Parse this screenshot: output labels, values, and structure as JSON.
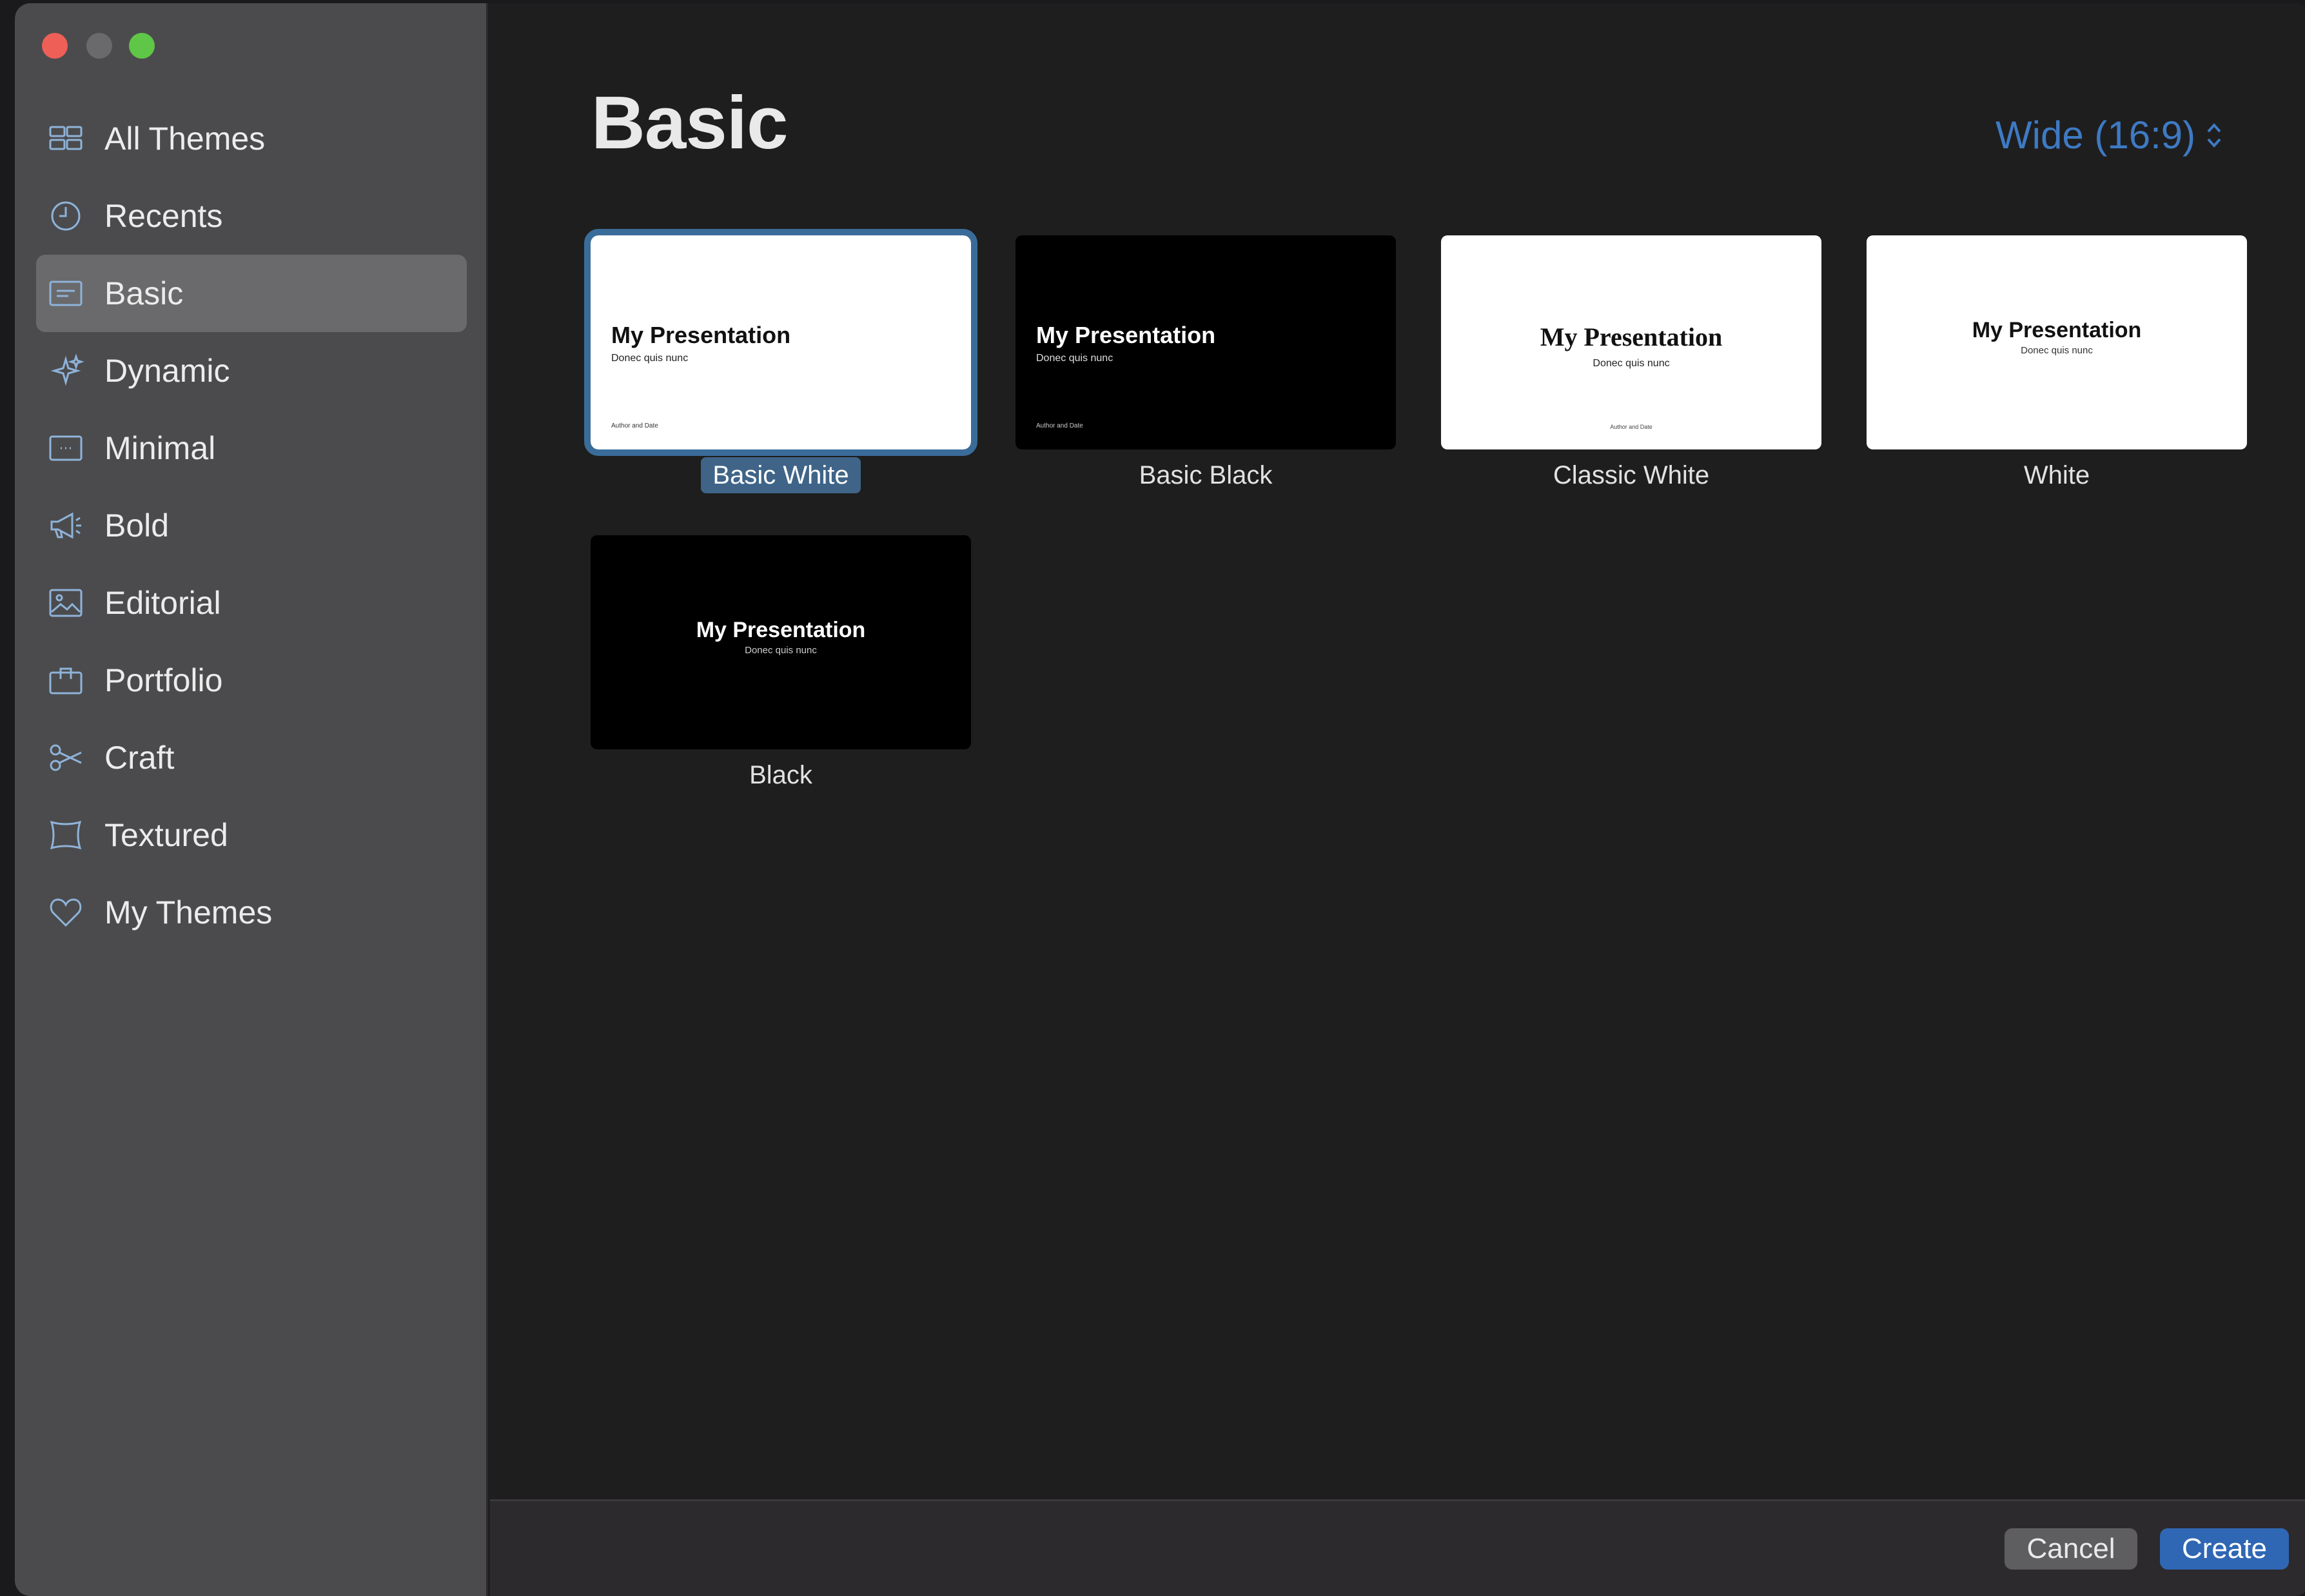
{
  "sidebar": {
    "items": [
      {
        "label": "All Themes",
        "icon": "grid-icon"
      },
      {
        "label": "Recents",
        "icon": "clock-icon"
      },
      {
        "label": "Basic",
        "icon": "slide-basic-icon",
        "selected": true
      },
      {
        "label": "Dynamic",
        "icon": "sparkles-icon"
      },
      {
        "label": "Minimal",
        "icon": "slide-minimal-icon"
      },
      {
        "label": "Bold",
        "icon": "megaphone-icon"
      },
      {
        "label": "Editorial",
        "icon": "photo-icon"
      },
      {
        "label": "Portfolio",
        "icon": "briefcase-icon"
      },
      {
        "label": "Craft",
        "icon": "scissors-icon"
      },
      {
        "label": "Textured",
        "icon": "frame-icon"
      },
      {
        "label": "My Themes",
        "icon": "heart-icon"
      }
    ]
  },
  "main": {
    "title": "Basic",
    "aspect": "Wide (16:9)",
    "themes": [
      {
        "name": "Basic White",
        "slide_title": "My Presentation",
        "slide_sub": "Donec quis nunc",
        "slide_author": "Author and Date"
      },
      {
        "name": "Basic Black",
        "slide_title": "My Presentation",
        "slide_sub": "Donec quis nunc",
        "slide_author": "Author and Date"
      },
      {
        "name": "Classic White",
        "slide_title": "My Presentation",
        "slide_sub": "Donec quis nunc",
        "slide_author": "Author and Date"
      },
      {
        "name": "White",
        "slide_title": "My Presentation",
        "slide_sub": "Donec quis nunc"
      },
      {
        "name": "Black",
        "slide_title": "My Presentation",
        "slide_sub": "Donec quis nunc"
      }
    ]
  },
  "footer": {
    "cancel_label": "Cancel",
    "create_label": "Create"
  },
  "colors": {
    "accent": "#2f67b4",
    "selection_outline": "#3a6c9a",
    "sidebar_bg": "#4b4b4d",
    "main_bg": "#1e1e1e"
  }
}
